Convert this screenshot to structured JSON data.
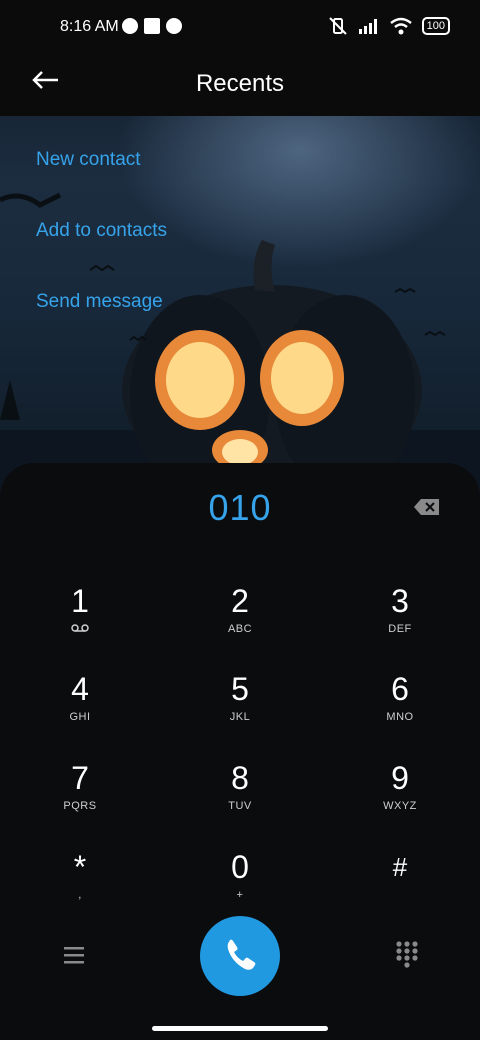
{
  "status_bar": {
    "time": "8:16 AM",
    "battery": "100"
  },
  "header": {
    "title": "Recents"
  },
  "menu": {
    "items": [
      "New contact",
      "Add to contacts",
      "Send message"
    ]
  },
  "dialer": {
    "number": "010",
    "keys": [
      {
        "digit": "1",
        "letters": ""
      },
      {
        "digit": "2",
        "letters": "ABC"
      },
      {
        "digit": "3",
        "letters": "DEF"
      },
      {
        "digit": "4",
        "letters": "GHI"
      },
      {
        "digit": "5",
        "letters": "JKL"
      },
      {
        "digit": "6",
        "letters": "MNO"
      },
      {
        "digit": "7",
        "letters": "PQRS"
      },
      {
        "digit": "8",
        "letters": "TUV"
      },
      {
        "digit": "9",
        "letters": "WXYZ"
      },
      {
        "digit": "*",
        "letters": ","
      },
      {
        "digit": "0",
        "letters": "+"
      },
      {
        "digit": "#",
        "letters": ""
      }
    ]
  },
  "colors": {
    "accent": "#36a3ea",
    "call_button": "#2199e0",
    "background": "#0b0c0e"
  },
  "icons": {
    "back": "arrow-left-icon",
    "backspace": "backspace-icon",
    "voicemail": "voicemail-icon",
    "call": "phone-icon",
    "menu": "hamburger-icon",
    "keypad": "keypad-icon"
  }
}
